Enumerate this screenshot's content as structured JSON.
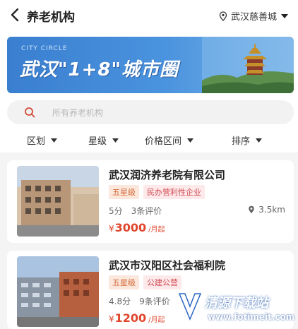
{
  "header": {
    "title": "养老机构",
    "location": "武汉慈善城",
    "icons": {
      "back": "back-arrow-icon",
      "location": "location-pin-icon",
      "dropdown": "caret-down-icon"
    }
  },
  "banner": {
    "caption": "CITY CIRCLE",
    "title": "武汉\"1+8\"城市圈"
  },
  "search": {
    "placeholder": "所有养老机构",
    "icon": "search-icon"
  },
  "filters": [
    {
      "label": "区划"
    },
    {
      "label": "星级"
    },
    {
      "label": "价格区间"
    },
    {
      "label": "排序"
    }
  ],
  "institutions": [
    {
      "name": "武汉润济养老院有限公司",
      "star_tag": "五星级",
      "type_tag": "民办营利性企业",
      "score": "5分",
      "reviews": "3条评价",
      "distance": "3.5km",
      "currency": "¥",
      "price": "3000",
      "price_unit": "/月起"
    },
    {
      "name": "武汉市汉阳区社会福利院",
      "star_tag": "五星级",
      "type_tag": "公建公营",
      "score": "4.8分",
      "reviews": "9条评价",
      "distance": "",
      "currency": "¥",
      "price": "1200",
      "price_unit": "/月起"
    }
  ],
  "watermark": {
    "text": "清源下载站",
    "url": "www.fotimeit.com"
  },
  "colors": {
    "accent": "#e0462c",
    "banner": "#3a7fd0",
    "star_tag_bg": "#fbe7dc",
    "type_tag_bg": "#fde9ea"
  }
}
